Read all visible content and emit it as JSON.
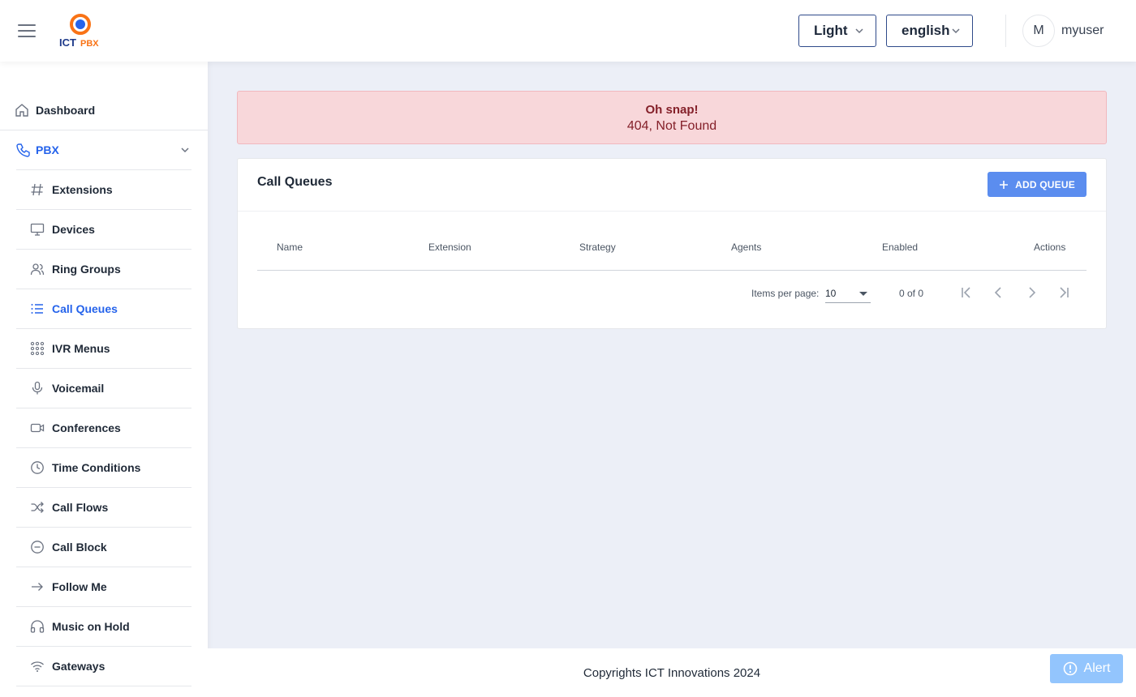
{
  "header": {
    "logo_text": "ICT PBX",
    "theme": "Light",
    "language": "english",
    "avatar_initial": "M",
    "username": "myuser"
  },
  "sidebar": {
    "dashboard": "Dashboard",
    "pbx": "PBX",
    "items": [
      {
        "label": "Extensions",
        "icon": "hash-icon",
        "active": false
      },
      {
        "label": "Devices",
        "icon": "monitor-icon",
        "active": false
      },
      {
        "label": "Ring Groups",
        "icon": "users-icon",
        "active": false
      },
      {
        "label": "Call Queues",
        "icon": "list-icon",
        "active": true
      },
      {
        "label": "IVR Menus",
        "icon": "keypad-icon",
        "active": false
      },
      {
        "label": "Voicemail",
        "icon": "microphone-icon",
        "active": false
      },
      {
        "label": "Conferences",
        "icon": "video-icon",
        "active": false
      },
      {
        "label": "Time Conditions",
        "icon": "clock-icon",
        "active": false
      },
      {
        "label": "Call Flows",
        "icon": "shuffle-icon",
        "active": false
      },
      {
        "label": "Call Block",
        "icon": "minus-circle-icon",
        "active": false
      },
      {
        "label": "Follow Me",
        "icon": "arrow-right-icon",
        "active": false
      },
      {
        "label": "Music on Hold",
        "icon": "headphones-icon",
        "active": false
      },
      {
        "label": "Gateways",
        "icon": "wifi-icon",
        "active": false
      }
    ]
  },
  "alert": {
    "title": "Oh snap!",
    "message": "404, Not Found"
  },
  "card": {
    "title": "Call Queues",
    "add_button": "ADD QUEUE",
    "columns": [
      "Name",
      "Extension",
      "Strategy",
      "Agents",
      "Enabled",
      "Actions"
    ]
  },
  "pagination": {
    "items_per_page_label": "Items per page:",
    "items_per_page": "10",
    "range": "0 of 0"
  },
  "footer": {
    "copyright": "Copyrights ICT Innovations 2024",
    "alert_button": "Alert"
  },
  "colors": {
    "accent": "#2563eb",
    "button": "#5b8def",
    "alert_bg": "#f8d7da",
    "alert_text": "#842029"
  }
}
